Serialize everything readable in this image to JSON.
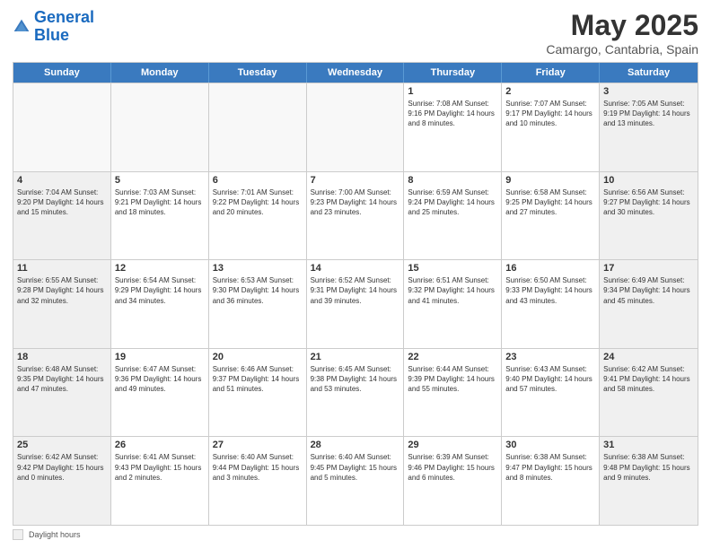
{
  "header": {
    "logo_line1": "General",
    "logo_line2": "Blue",
    "title": "May 2025",
    "subtitle": "Camargo, Cantabria, Spain"
  },
  "calendar": {
    "days_of_week": [
      "Sunday",
      "Monday",
      "Tuesday",
      "Wednesday",
      "Thursday",
      "Friday",
      "Saturday"
    ],
    "weeks": [
      [
        {
          "num": "",
          "info": "",
          "empty": true
        },
        {
          "num": "",
          "info": "",
          "empty": true
        },
        {
          "num": "",
          "info": "",
          "empty": true
        },
        {
          "num": "",
          "info": "",
          "empty": true
        },
        {
          "num": "1",
          "info": "Sunrise: 7:08 AM\nSunset: 9:16 PM\nDaylight: 14 hours\nand 8 minutes.",
          "empty": false
        },
        {
          "num": "2",
          "info": "Sunrise: 7:07 AM\nSunset: 9:17 PM\nDaylight: 14 hours\nand 10 minutes.",
          "empty": false
        },
        {
          "num": "3",
          "info": "Sunrise: 7:05 AM\nSunset: 9:19 PM\nDaylight: 14 hours\nand 13 minutes.",
          "empty": false,
          "shaded": true
        }
      ],
      [
        {
          "num": "4",
          "info": "Sunrise: 7:04 AM\nSunset: 9:20 PM\nDaylight: 14 hours\nand 15 minutes.",
          "shaded": true
        },
        {
          "num": "5",
          "info": "Sunrise: 7:03 AM\nSunset: 9:21 PM\nDaylight: 14 hours\nand 18 minutes."
        },
        {
          "num": "6",
          "info": "Sunrise: 7:01 AM\nSunset: 9:22 PM\nDaylight: 14 hours\nand 20 minutes."
        },
        {
          "num": "7",
          "info": "Sunrise: 7:00 AM\nSunset: 9:23 PM\nDaylight: 14 hours\nand 23 minutes."
        },
        {
          "num": "8",
          "info": "Sunrise: 6:59 AM\nSunset: 9:24 PM\nDaylight: 14 hours\nand 25 minutes."
        },
        {
          "num": "9",
          "info": "Sunrise: 6:58 AM\nSunset: 9:25 PM\nDaylight: 14 hours\nand 27 minutes."
        },
        {
          "num": "10",
          "info": "Sunrise: 6:56 AM\nSunset: 9:27 PM\nDaylight: 14 hours\nand 30 minutes.",
          "shaded": true
        }
      ],
      [
        {
          "num": "11",
          "info": "Sunrise: 6:55 AM\nSunset: 9:28 PM\nDaylight: 14 hours\nand 32 minutes.",
          "shaded": true
        },
        {
          "num": "12",
          "info": "Sunrise: 6:54 AM\nSunset: 9:29 PM\nDaylight: 14 hours\nand 34 minutes."
        },
        {
          "num": "13",
          "info": "Sunrise: 6:53 AM\nSunset: 9:30 PM\nDaylight: 14 hours\nand 36 minutes."
        },
        {
          "num": "14",
          "info": "Sunrise: 6:52 AM\nSunset: 9:31 PM\nDaylight: 14 hours\nand 39 minutes."
        },
        {
          "num": "15",
          "info": "Sunrise: 6:51 AM\nSunset: 9:32 PM\nDaylight: 14 hours\nand 41 minutes."
        },
        {
          "num": "16",
          "info": "Sunrise: 6:50 AM\nSunset: 9:33 PM\nDaylight: 14 hours\nand 43 minutes."
        },
        {
          "num": "17",
          "info": "Sunrise: 6:49 AM\nSunset: 9:34 PM\nDaylight: 14 hours\nand 45 minutes.",
          "shaded": true
        }
      ],
      [
        {
          "num": "18",
          "info": "Sunrise: 6:48 AM\nSunset: 9:35 PM\nDaylight: 14 hours\nand 47 minutes.",
          "shaded": true
        },
        {
          "num": "19",
          "info": "Sunrise: 6:47 AM\nSunset: 9:36 PM\nDaylight: 14 hours\nand 49 minutes."
        },
        {
          "num": "20",
          "info": "Sunrise: 6:46 AM\nSunset: 9:37 PM\nDaylight: 14 hours\nand 51 minutes."
        },
        {
          "num": "21",
          "info": "Sunrise: 6:45 AM\nSunset: 9:38 PM\nDaylight: 14 hours\nand 53 minutes."
        },
        {
          "num": "22",
          "info": "Sunrise: 6:44 AM\nSunset: 9:39 PM\nDaylight: 14 hours\nand 55 minutes."
        },
        {
          "num": "23",
          "info": "Sunrise: 6:43 AM\nSunset: 9:40 PM\nDaylight: 14 hours\nand 57 minutes."
        },
        {
          "num": "24",
          "info": "Sunrise: 6:42 AM\nSunset: 9:41 PM\nDaylight: 14 hours\nand 58 minutes.",
          "shaded": true
        }
      ],
      [
        {
          "num": "25",
          "info": "Sunrise: 6:42 AM\nSunset: 9:42 PM\nDaylight: 15 hours\nand 0 minutes.",
          "shaded": true
        },
        {
          "num": "26",
          "info": "Sunrise: 6:41 AM\nSunset: 9:43 PM\nDaylight: 15 hours\nand 2 minutes."
        },
        {
          "num": "27",
          "info": "Sunrise: 6:40 AM\nSunset: 9:44 PM\nDaylight: 15 hours\nand 3 minutes."
        },
        {
          "num": "28",
          "info": "Sunrise: 6:40 AM\nSunset: 9:45 PM\nDaylight: 15 hours\nand 5 minutes."
        },
        {
          "num": "29",
          "info": "Sunrise: 6:39 AM\nSunset: 9:46 PM\nDaylight: 15 hours\nand 6 minutes."
        },
        {
          "num": "30",
          "info": "Sunrise: 6:38 AM\nSunset: 9:47 PM\nDaylight: 15 hours\nand 8 minutes."
        },
        {
          "num": "31",
          "info": "Sunrise: 6:38 AM\nSunset: 9:48 PM\nDaylight: 15 hours\nand 9 minutes.",
          "shaded": true
        }
      ]
    ]
  },
  "footer": {
    "shaded_label": "Daylight hours"
  }
}
